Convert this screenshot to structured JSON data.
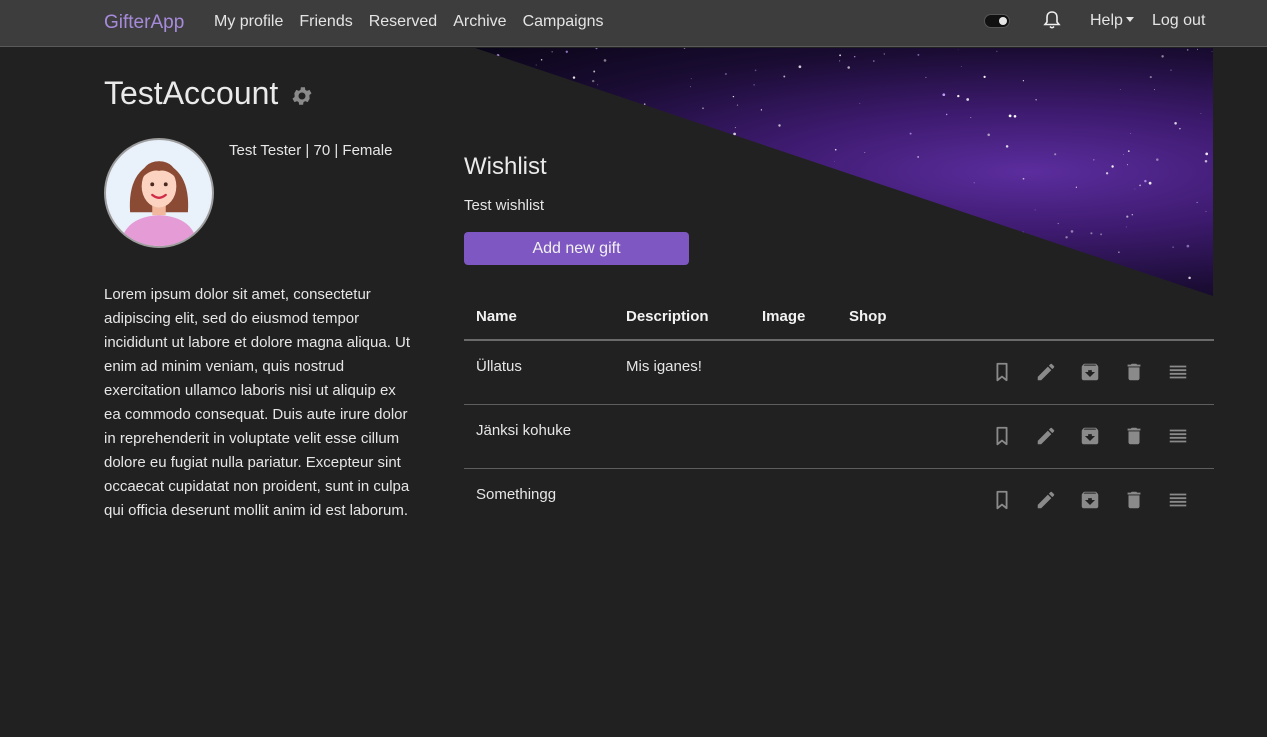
{
  "navbar": {
    "brand": "GifterApp",
    "links": [
      "My profile",
      "Friends",
      "Reserved",
      "Archive",
      "Campaigns"
    ],
    "help": "Help",
    "logout": "Log out",
    "icons": [
      "theme-toggle",
      "bell-icon",
      "chevron-down-icon"
    ]
  },
  "profile": {
    "account_name": "TestAccount",
    "user_info": "Test Tester | 70 | Female",
    "bio": "Lorem ipsum dolor sit amet, consectetur adipiscing elit, sed do eiusmod tempor incididunt ut labore et dolore magna aliqua. Ut enim ad minim veniam, quis nostrud exercitation ullamco laboris nisi ut aliquip ex ea commodo consequat. Duis aute irure dolor in reprehenderit in voluptate velit esse cillum dolore eu fugiat nulla pariatur. Excepteur sint occaecat cupidatat non proident, sunt in culpa qui officia deserunt mollit anim id est laborum."
  },
  "wishlist": {
    "title": "Wishlist",
    "subtitle": "Test wishlist",
    "add_button": "Add new gift",
    "columns": [
      "Name",
      "Description",
      "Image",
      "Shop"
    ],
    "rows": [
      {
        "name": "Üllatus",
        "description": "Mis iganes!"
      },
      {
        "name": "Jänksi kohuke",
        "description": ""
      },
      {
        "name": "Somethingg",
        "description": ""
      }
    ],
    "row_actions": [
      "bookmark-icon",
      "pencil-icon",
      "archive-icon",
      "trash-icon",
      "drag-handle-icon"
    ]
  },
  "colors": {
    "background": "#212121",
    "navbar": "#3d3d3d",
    "accent": "#7e57c2",
    "brand": "#a78bdb",
    "icon": "#8a8a8a"
  }
}
